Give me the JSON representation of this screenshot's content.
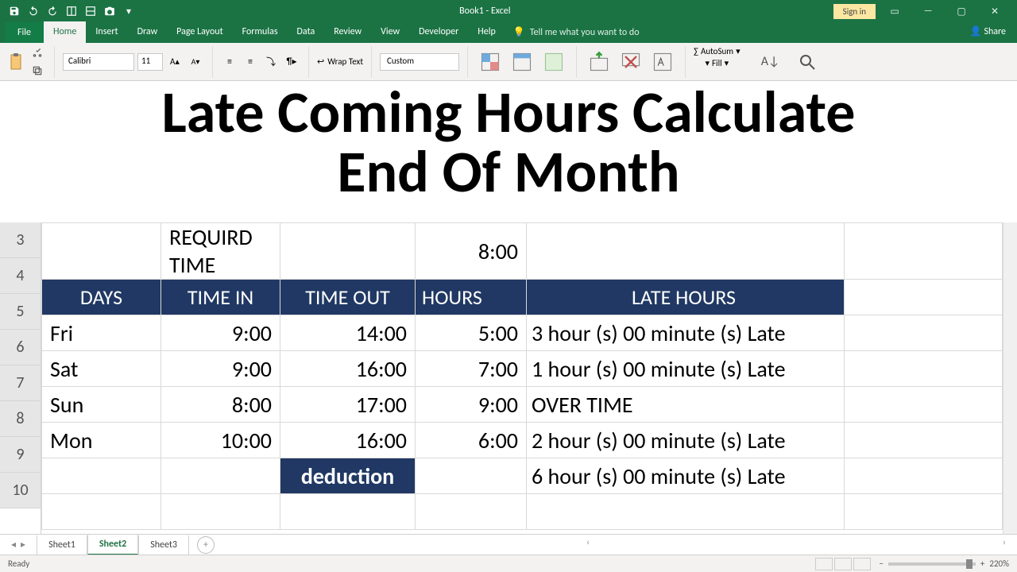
{
  "titlebar": {
    "appTitle": "Book1  -  Excel",
    "signIn": "Sign in"
  },
  "tabs": {
    "file": "File",
    "home": "Home",
    "insert": "Insert",
    "draw": "Draw",
    "pageLayout": "Page Layout",
    "formulas": "Formulas",
    "data": "Data",
    "review": "Review",
    "view": "View",
    "developer": "Developer",
    "help": "Help",
    "tellMe": "Tell me what you want to do",
    "share": "Share"
  },
  "ribbon": {
    "fontName": "Calibri",
    "fontSize": "11",
    "wrap": "Wrap Text",
    "numberFormat": "Custom",
    "autosum": "AutoSum",
    "fill": "Fill"
  },
  "overlay": {
    "line1": "Late Coming Hours Calculate",
    "line2": "End Of Month"
  },
  "sheet": {
    "requiredLabel": "REQUIRD TIME",
    "requiredTime": "8:00",
    "headers": {
      "days": "DAYS",
      "timeIn": "TIME IN",
      "timeOut": "TIME OUT",
      "hours": "HOURS",
      "late": "LATE HOURS"
    },
    "rows": [
      {
        "num": "5",
        "day": "Fri",
        "in": "9:00",
        "out": "14:00",
        "hours": "5:00",
        "late": " 3  hour (s) 00 minute (s) Late"
      },
      {
        "num": "6",
        "day": "Sat",
        "in": "9:00",
        "out": "16:00",
        "hours": "7:00",
        "late": " 1  hour (s) 00 minute (s) Late"
      },
      {
        "num": "7",
        "day": "Sun",
        "in": "8:00",
        "out": "17:00",
        "hours": "9:00",
        "late": "OVER TIME"
      },
      {
        "num": "8",
        "day": "Mon",
        "in": "10:00",
        "out": "16:00",
        "hours": "6:00",
        "late": " 2  hour (s) 00 minute (s) Late"
      }
    ],
    "deductionLabel": "deduction",
    "deductionValue": " 6  hour (s) 00 minute (s) Late",
    "rowNums": {
      "r3": "3",
      "r4": "4",
      "r9": "9",
      "r10": "10"
    }
  },
  "sheetTabs": {
    "s1": "Sheet1",
    "s2": "Sheet2",
    "s3": "Sheet3"
  },
  "status": {
    "ready": "Ready",
    "zoom": "220%"
  }
}
